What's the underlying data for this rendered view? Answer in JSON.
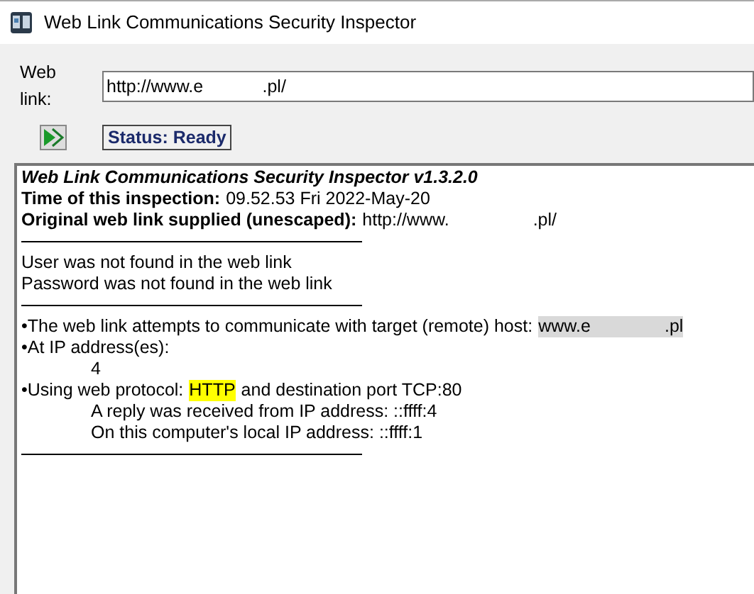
{
  "window": {
    "title": "Web Link Communications Security Inspector"
  },
  "web_link": {
    "label": "Web link:",
    "value": "http://www.e            .pl/"
  },
  "status": "Status: Ready",
  "report": [
    {
      "kind": "title",
      "text": "Web Link Communications Security Inspector v1.3.2.0"
    },
    {
      "kind": "field",
      "label": "Time of this inspection:",
      "value": "09.52.53 Fri 2022-May-20"
    },
    {
      "kind": "field",
      "label": "Original web link supplied (unescaped):",
      "value": "http://www.                 .pl/"
    },
    {
      "kind": "rule"
    },
    {
      "kind": "text",
      "text": "User was not found in the web link"
    },
    {
      "kind": "text",
      "text": "Password was not found in the web link"
    },
    {
      "kind": "rule"
    },
    {
      "kind": "mark",
      "text": "•The web link attempts to communicate with target (remote) host:",
      "highlight": "www.e               .pl",
      "color": "#d9d9d9"
    },
    {
      "kind": "text",
      "text": "•At IP address(es):"
    },
    {
      "kind": "indented",
      "text": "4"
    },
    {
      "kind": "mark",
      "text": "•Using web protocol:",
      "highlight": "HTTP",
      "after": "and destination port TCP:80",
      "color": "#ffff00"
    },
    {
      "kind": "indented",
      "text": "A reply was received from IP address: ::ffff:4"
    },
    {
      "kind": "indented",
      "text": "On this computer's local IP address: ::ffff:1"
    },
    {
      "kind": "rule"
    }
  ]
}
